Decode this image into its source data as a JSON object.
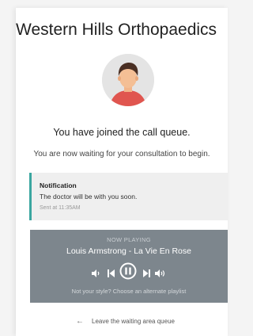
{
  "header": {
    "title": "Western Hills Orthopaedics"
  },
  "status": {
    "heading": "You have joined the call queue.",
    "subtext": "You are now waiting for your consultation to begin."
  },
  "notification": {
    "title": "Notification",
    "message": "The doctor will be with you soon.",
    "timestamp": "Sent at 11:35AM",
    "accent_color": "#3aa6a0"
  },
  "player": {
    "label": "NOW PLAYING",
    "track": "Louis Armstrong - La Vie En Rose",
    "is_playing": true,
    "background_color": "#7d868d",
    "alternate_link": "Not your style? Choose an alternate playlist",
    "icons": [
      "volume-down-icon",
      "previous-track-icon",
      "pause-icon",
      "next-track-icon",
      "volume-up-icon"
    ]
  },
  "footer": {
    "leave_icon": "arrow-left-icon",
    "leave_label": "Leave the waiting area queue"
  }
}
